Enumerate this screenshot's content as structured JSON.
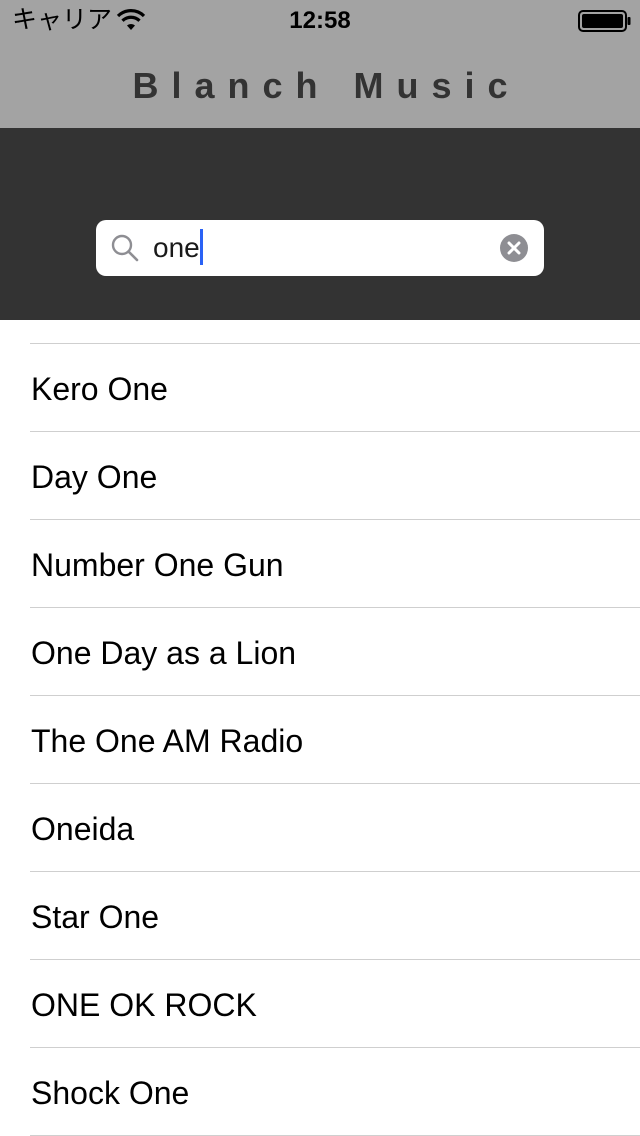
{
  "status_bar": {
    "carrier": "キャリア",
    "time": "12:58",
    "wifi_icon": "wifi-icon",
    "battery_icon": "battery-icon"
  },
  "header": {
    "title": "Blanch Music"
  },
  "search": {
    "value": "one",
    "search_icon": "search-icon",
    "clear_icon": "clear-icon"
  },
  "results": [
    "Kero One",
    "Day One",
    "Number One Gun",
    "One Day as a Lion",
    "The One AM Radio",
    "Oneida",
    "Star One",
    "ONE OK ROCK",
    "Shock One"
  ],
  "colors": {
    "header_bg": "#a3a3a3",
    "search_area_bg": "#333333",
    "title_text": "#333333",
    "caret": "#2a62f5"
  }
}
